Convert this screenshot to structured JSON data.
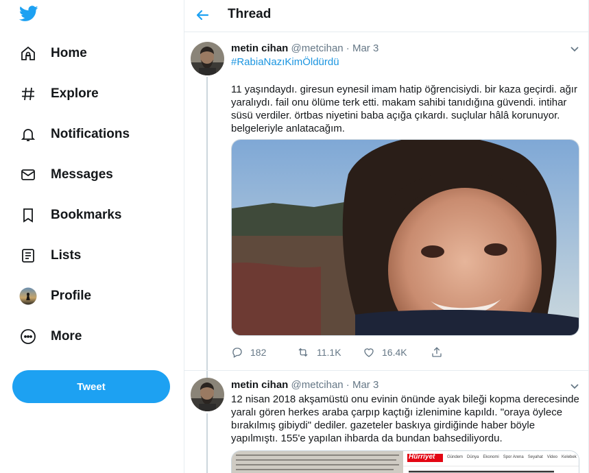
{
  "sidebar": {
    "logo": "twitter-bird-icon",
    "items": [
      {
        "label": "Home",
        "icon": "home-icon"
      },
      {
        "label": "Explore",
        "icon": "hashtag-icon"
      },
      {
        "label": "Notifications",
        "icon": "bell-icon"
      },
      {
        "label": "Messages",
        "icon": "envelope-icon"
      },
      {
        "label": "Bookmarks",
        "icon": "bookmark-icon"
      },
      {
        "label": "Lists",
        "icon": "list-icon"
      },
      {
        "label": "Profile",
        "icon": "avatar-icon"
      },
      {
        "label": "More",
        "icon": "more-icon"
      }
    ],
    "tweet_button": "Tweet"
  },
  "header": {
    "title": "Thread"
  },
  "tweets": [
    {
      "name": "metin cihan",
      "handle": "@metcihan",
      "separator": "·",
      "date": "Mar 3",
      "hashtag": "#RabiaNazıKimÖldürdü",
      "text": "11 yaşındaydı. giresun eynesil imam hatip öğrencisiydi. bir kaza geçirdi. ağır yaralıydı. fail onu ölüme terk etti. makam sahibi tanıdığına güvendi. intihar süsü verdiler. örtbas niyetini baba açığa çıkardı. suçlular hâlâ korunuyor. belgeleriyle anlatacağım.",
      "replies": "182",
      "retweets": "11.1K",
      "likes": "16.4K"
    },
    {
      "name": "metin cihan",
      "handle": "@metcihan",
      "separator": "·",
      "date": "Mar 3",
      "text": "12 nisan 2018 akşamüstü onu evinin önünde ayak bileği kopma derecesinde yaralı gören herkes araba çarpıp kaçtığı izlenimine kapıldı. \"oraya öylece bırakılmış gibiydi\" dediler. gazeteler baskıya girdiğinde haber böyle yapılmıştı. 155'e yapılan ihbarda da bundan bahsediliyordu.",
      "newspaper_brand": "Hürriyet",
      "newspaper_nav": [
        "Gündem",
        "Dünya",
        "Ekonomi",
        "Spor Arena",
        "Seyahat",
        "Video",
        "Kelebek"
      ]
    }
  ],
  "colors": {
    "accent": "#1da1f2",
    "text": "#14171a",
    "muted": "#657786",
    "border": "#e6ecf0",
    "newspaper_red": "#e30613"
  }
}
